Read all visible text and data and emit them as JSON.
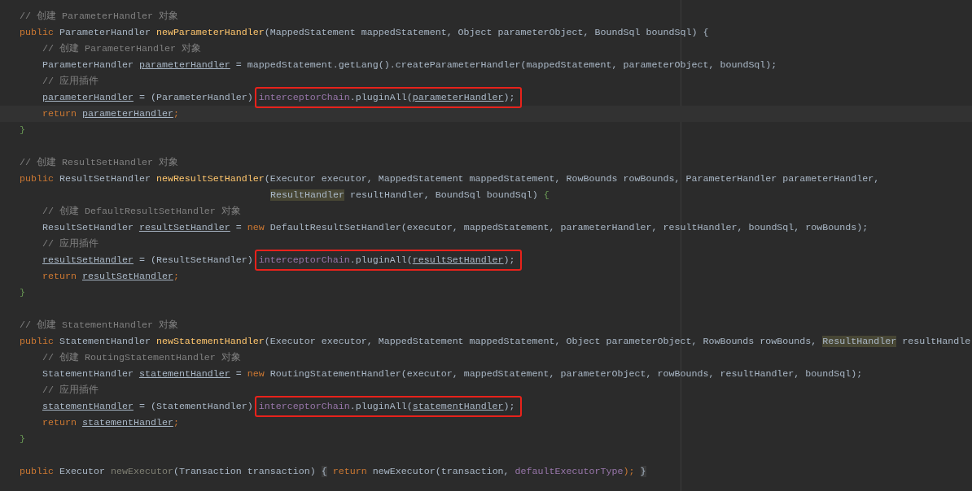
{
  "editor": {
    "blocks": [
      {
        "lines": [
          {
            "segments": [
              {
                "text": "// 创建 ParameterHandler 对象",
                "kind": "comment"
              }
            ]
          },
          {
            "segments": [
              {
                "text": "public ",
                "kind": "keyword"
              },
              {
                "text": "ParameterHandler ",
                "kind": "plain"
              },
              {
                "text": "newParameterHandler",
                "kind": "decl"
              },
              {
                "text": "(MappedStatement mappedStatement, Object parameterObject, BoundSql boundSql) {",
                "kind": "plain"
              }
            ],
            "children": [
              {
                "segments": [
                  {
                    "text": "// 创建 ParameterHandler 对象",
                    "kind": "comment"
                  }
                ]
              },
              {
                "segments": [
                  {
                    "text": "ParameterHandler ",
                    "kind": "plain"
                  },
                  {
                    "text": "parameterHandler",
                    "kind": "local"
                  },
                  {
                    "text": " = mappedStatement.getLang().createParameterHandler(mappedStatement, parameterObject, boundSql);",
                    "kind": "plain"
                  }
                ]
              },
              {
                "segments": [
                  {
                    "text": "// 应用插件",
                    "kind": "comment"
                  }
                ]
              },
              {
                "segments": [
                  {
                    "text": "parameterHandler",
                    "kind": "local"
                  },
                  {
                    "text": " = (ParameterHandler) ",
                    "kind": "plain"
                  },
                  {
                    "text": "interceptorChain",
                    "kind": "field",
                    "boxed": true
                  },
                  {
                    "text": ".pluginAll(",
                    "kind": "plain",
                    "boxed": true
                  },
                  {
                    "text": "parameterHandler",
                    "kind": "local",
                    "boxed": true
                  },
                  {
                    "text": ");",
                    "kind": "plain",
                    "boxed": true
                  }
                ]
              },
              {
                "current": true,
                "segments": [
                  {
                    "text": "return ",
                    "kind": "keyword"
                  },
                  {
                    "text": "parameterHandler",
                    "kind": "local"
                  },
                  {
                    "text": ";",
                    "kind": "keyword"
                  }
                ]
              }
            ]
          },
          {
            "segments": [
              {
                "text": "}",
                "kind": "brace"
              }
            ]
          }
        ]
      },
      {
        "lines": [
          {
            "segments": [
              {
                "text": "// 创建 ResultSetHandler 对象",
                "kind": "comment"
              }
            ]
          },
          {
            "segments": [
              {
                "text": "public ",
                "kind": "keyword"
              },
              {
                "text": "ResultSetHandler ",
                "kind": "plain"
              },
              {
                "text": "newResultSetHandler",
                "kind": "decl"
              },
              {
                "text": "(Executor executor, MappedStatement mappedStatement, RowBounds rowBounds, ParameterHandler parameterHandler,",
                "kind": "plain"
              }
            ]
          },
          {
            "wrapped": true,
            "segments": [
              {
                "text": "ResultHandler",
                "kind": "plain",
                "marked": true
              },
              {
                "text": " resultHandler, BoundSql boundSql) ",
                "kind": "plain"
              },
              {
                "text": "{",
                "kind": "brace"
              }
            ],
            "children": [
              {
                "segments": [
                  {
                    "text": "// 创建 DefaultResultSetHandler 对象",
                    "kind": "comment"
                  }
                ]
              },
              {
                "segments": [
                  {
                    "text": "ResultSetHandler ",
                    "kind": "plain"
                  },
                  {
                    "text": "resultSetHandler",
                    "kind": "local"
                  },
                  {
                    "text": " = ",
                    "kind": "plain"
                  },
                  {
                    "text": "new ",
                    "kind": "keyword"
                  },
                  {
                    "text": "DefaultResultSetHandler(executor, mappedStatement, parameterHandler, resultHandler, boundSql, rowBounds);",
                    "kind": "plain"
                  }
                ]
              },
              {
                "segments": [
                  {
                    "text": "// 应用插件",
                    "kind": "comment"
                  }
                ]
              },
              {
                "segments": [
                  {
                    "text": "resultSetHandler",
                    "kind": "local"
                  },
                  {
                    "text": " = (ResultSetHandler) ",
                    "kind": "plain"
                  },
                  {
                    "text": "interceptorChain",
                    "kind": "field",
                    "boxed": true
                  },
                  {
                    "text": ".pluginAll(",
                    "kind": "plain",
                    "boxed": true
                  },
                  {
                    "text": "resultSetHandler",
                    "kind": "local",
                    "boxed": true
                  },
                  {
                    "text": ");",
                    "kind": "plain",
                    "boxed": true
                  }
                ]
              },
              {
                "segments": [
                  {
                    "text": "return ",
                    "kind": "keyword"
                  },
                  {
                    "text": "resultSetHandler",
                    "kind": "local"
                  },
                  {
                    "text": ";",
                    "kind": "keyword"
                  }
                ]
              }
            ]
          },
          {
            "segments": [
              {
                "text": "}",
                "kind": "brace"
              }
            ]
          }
        ]
      },
      {
        "lines": [
          {
            "segments": [
              {
                "text": "// 创建 StatementHandler 对象",
                "kind": "comment"
              }
            ]
          },
          {
            "segments": [
              {
                "text": "public ",
                "kind": "keyword"
              },
              {
                "text": "StatementHandler ",
                "kind": "plain"
              },
              {
                "text": "newStatementHandler",
                "kind": "decl"
              },
              {
                "text": "(Executor executor, MappedStatement mappedStatement, Object parameterObject, RowBounds rowBounds, ",
                "kind": "plain"
              },
              {
                "text": "ResultHandler",
                "kind": "plain",
                "marked": true
              },
              {
                "text": " resultHandle",
                "kind": "plain"
              }
            ],
            "children": [
              {
                "segments": [
                  {
                    "text": "// 创建 RoutingStatementHandler 对象",
                    "kind": "comment"
                  }
                ]
              },
              {
                "segments": [
                  {
                    "text": "StatementHandler ",
                    "kind": "plain"
                  },
                  {
                    "text": "statementHandler",
                    "kind": "local"
                  },
                  {
                    "text": " = ",
                    "kind": "plain"
                  },
                  {
                    "text": "new ",
                    "kind": "keyword"
                  },
                  {
                    "text": "RoutingStatementHandler(executor, mappedStatement, parameterObject, rowBounds, resultHandler, boundSql);",
                    "kind": "plain"
                  }
                ]
              },
              {
                "segments": [
                  {
                    "text": "// 应用插件",
                    "kind": "comment"
                  }
                ]
              },
              {
                "segments": [
                  {
                    "text": "statementHandler",
                    "kind": "local"
                  },
                  {
                    "text": " = (StatementHandler) ",
                    "kind": "plain"
                  },
                  {
                    "text": "interceptorChain",
                    "kind": "field",
                    "boxed": true
                  },
                  {
                    "text": ".pluginAll(",
                    "kind": "plain",
                    "boxed": true
                  },
                  {
                    "text": "statementHandler",
                    "kind": "local",
                    "boxed": true
                  },
                  {
                    "text": ");",
                    "kind": "plain",
                    "boxed": true
                  }
                ]
              },
              {
                "segments": [
                  {
                    "text": "return ",
                    "kind": "keyword"
                  },
                  {
                    "text": "statementHandler",
                    "kind": "local"
                  },
                  {
                    "text": ";",
                    "kind": "keyword"
                  }
                ]
              }
            ]
          },
          {
            "segments": [
              {
                "text": "}",
                "kind": "brace"
              }
            ]
          }
        ]
      },
      {
        "lines": [
          {
            "segments": [
              {
                "text": "public ",
                "kind": "keyword"
              },
              {
                "text": "Executor ",
                "kind": "plain"
              },
              {
                "text": "newExecutor",
                "kind": "unused"
              },
              {
                "text": "(Transaction transaction) ",
                "kind": "plain"
              },
              {
                "text": "{",
                "kind": "fold"
              },
              {
                "text": " return ",
                "kind": "keyword"
              },
              {
                "text": "newExecutor(transaction, ",
                "kind": "plain"
              },
              {
                "text": "defaultExecutorType",
                "kind": "field"
              },
              {
                "text": "); ",
                "kind": "keyword"
              },
              {
                "text": "}",
                "kind": "fold"
              }
            ]
          }
        ]
      }
    ]
  }
}
